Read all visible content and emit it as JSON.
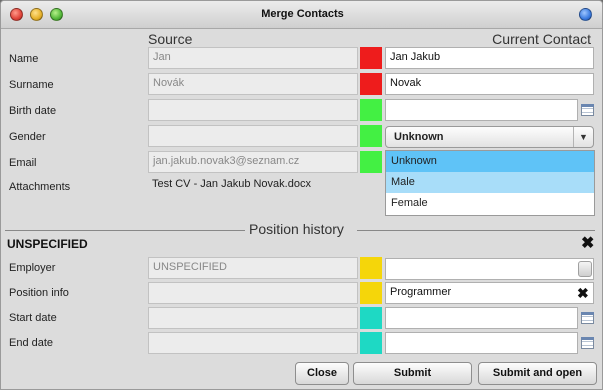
{
  "window": {
    "title": "Merge Contacts"
  },
  "columns": {
    "source": "Source",
    "current": "Current Contact"
  },
  "fields": [
    {
      "label": "Name",
      "source": "Jan",
      "current": "Jan Jakub",
      "marker_color": "#ee1c1c"
    },
    {
      "label": "Surname",
      "source": "Novák",
      "current": "Novak",
      "marker_color": "#ee1c1c"
    },
    {
      "label": "Birth date",
      "source": "",
      "current": "",
      "marker_color": "#43f043"
    },
    {
      "label": "Gender",
      "source": "",
      "current": "Unknown",
      "marker_color": "#43f043"
    },
    {
      "label": "Email",
      "source": "jan.jakub.novak3@seznam.cz",
      "current": "",
      "marker_color": "#43f043"
    },
    {
      "label": "Attachments",
      "source": "Test CV - Jan Jakub Novak.docx"
    }
  ],
  "gender_options": [
    {
      "label": "Unknown",
      "state": "selected",
      "bg": "#5fc3f7"
    },
    {
      "label": "Male",
      "state": "hover",
      "bg": "#a8ddf9"
    },
    {
      "label": "Female",
      "state": "normal",
      "bg": "#ffffff"
    }
  ],
  "position_history": {
    "title": "Position history",
    "group": "UNSPECIFIED",
    "fields": [
      {
        "label": "Employer",
        "source": "UNSPECIFIED",
        "current": "",
        "marker_color": "#f5d60a"
      },
      {
        "label": "Position info",
        "source": "",
        "current": "Programmer",
        "marker_color": "#f5d60a"
      },
      {
        "label": "Start date",
        "source": "",
        "current": "",
        "marker_color": "#1ed9c4"
      },
      {
        "label": "End date",
        "source": "",
        "current": "",
        "marker_color": "#1ed9c4"
      }
    ]
  },
  "buttons": {
    "close": "Close",
    "submit": "Submit",
    "submit_open": "Submit and open"
  },
  "icons": {
    "clear": "✖",
    "dropdown": "▼"
  }
}
